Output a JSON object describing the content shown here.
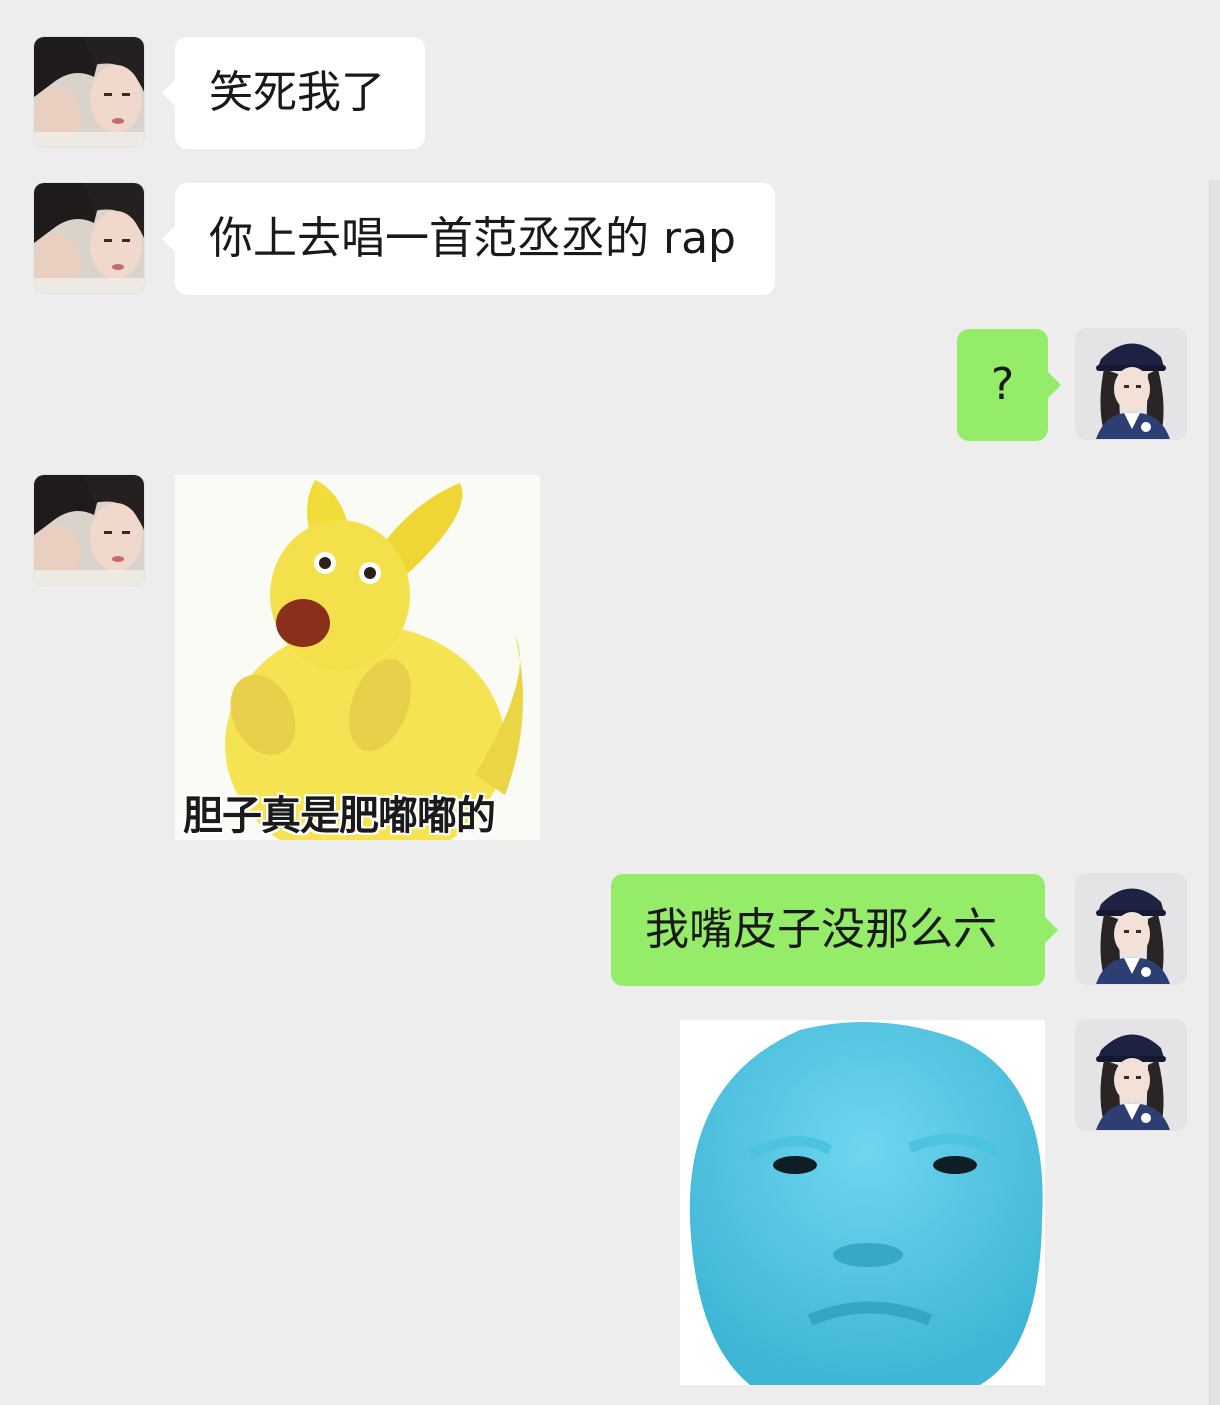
{
  "chat": {
    "messages": [
      {
        "sender": "contact",
        "type": "text",
        "text": "笑死我了"
      },
      {
        "sender": "contact",
        "type": "text",
        "text": "你上去唱一首范丞丞的 rap"
      },
      {
        "sender": "me",
        "type": "text",
        "text": "?"
      },
      {
        "sender": "contact",
        "type": "sticker",
        "sticker": "yellow-kangaroo-sticker",
        "caption": "胆子真是肥嘟嘟的"
      },
      {
        "sender": "me",
        "type": "text",
        "text": "我嘴皮子没那么六"
      },
      {
        "sender": "me",
        "type": "sticker",
        "sticker": "blue-face-sticker"
      }
    ]
  },
  "colors": {
    "background": "#ededed",
    "incoming_bubble": "#ffffff",
    "outgoing_bubble": "#95ec69",
    "text": "#191919"
  }
}
